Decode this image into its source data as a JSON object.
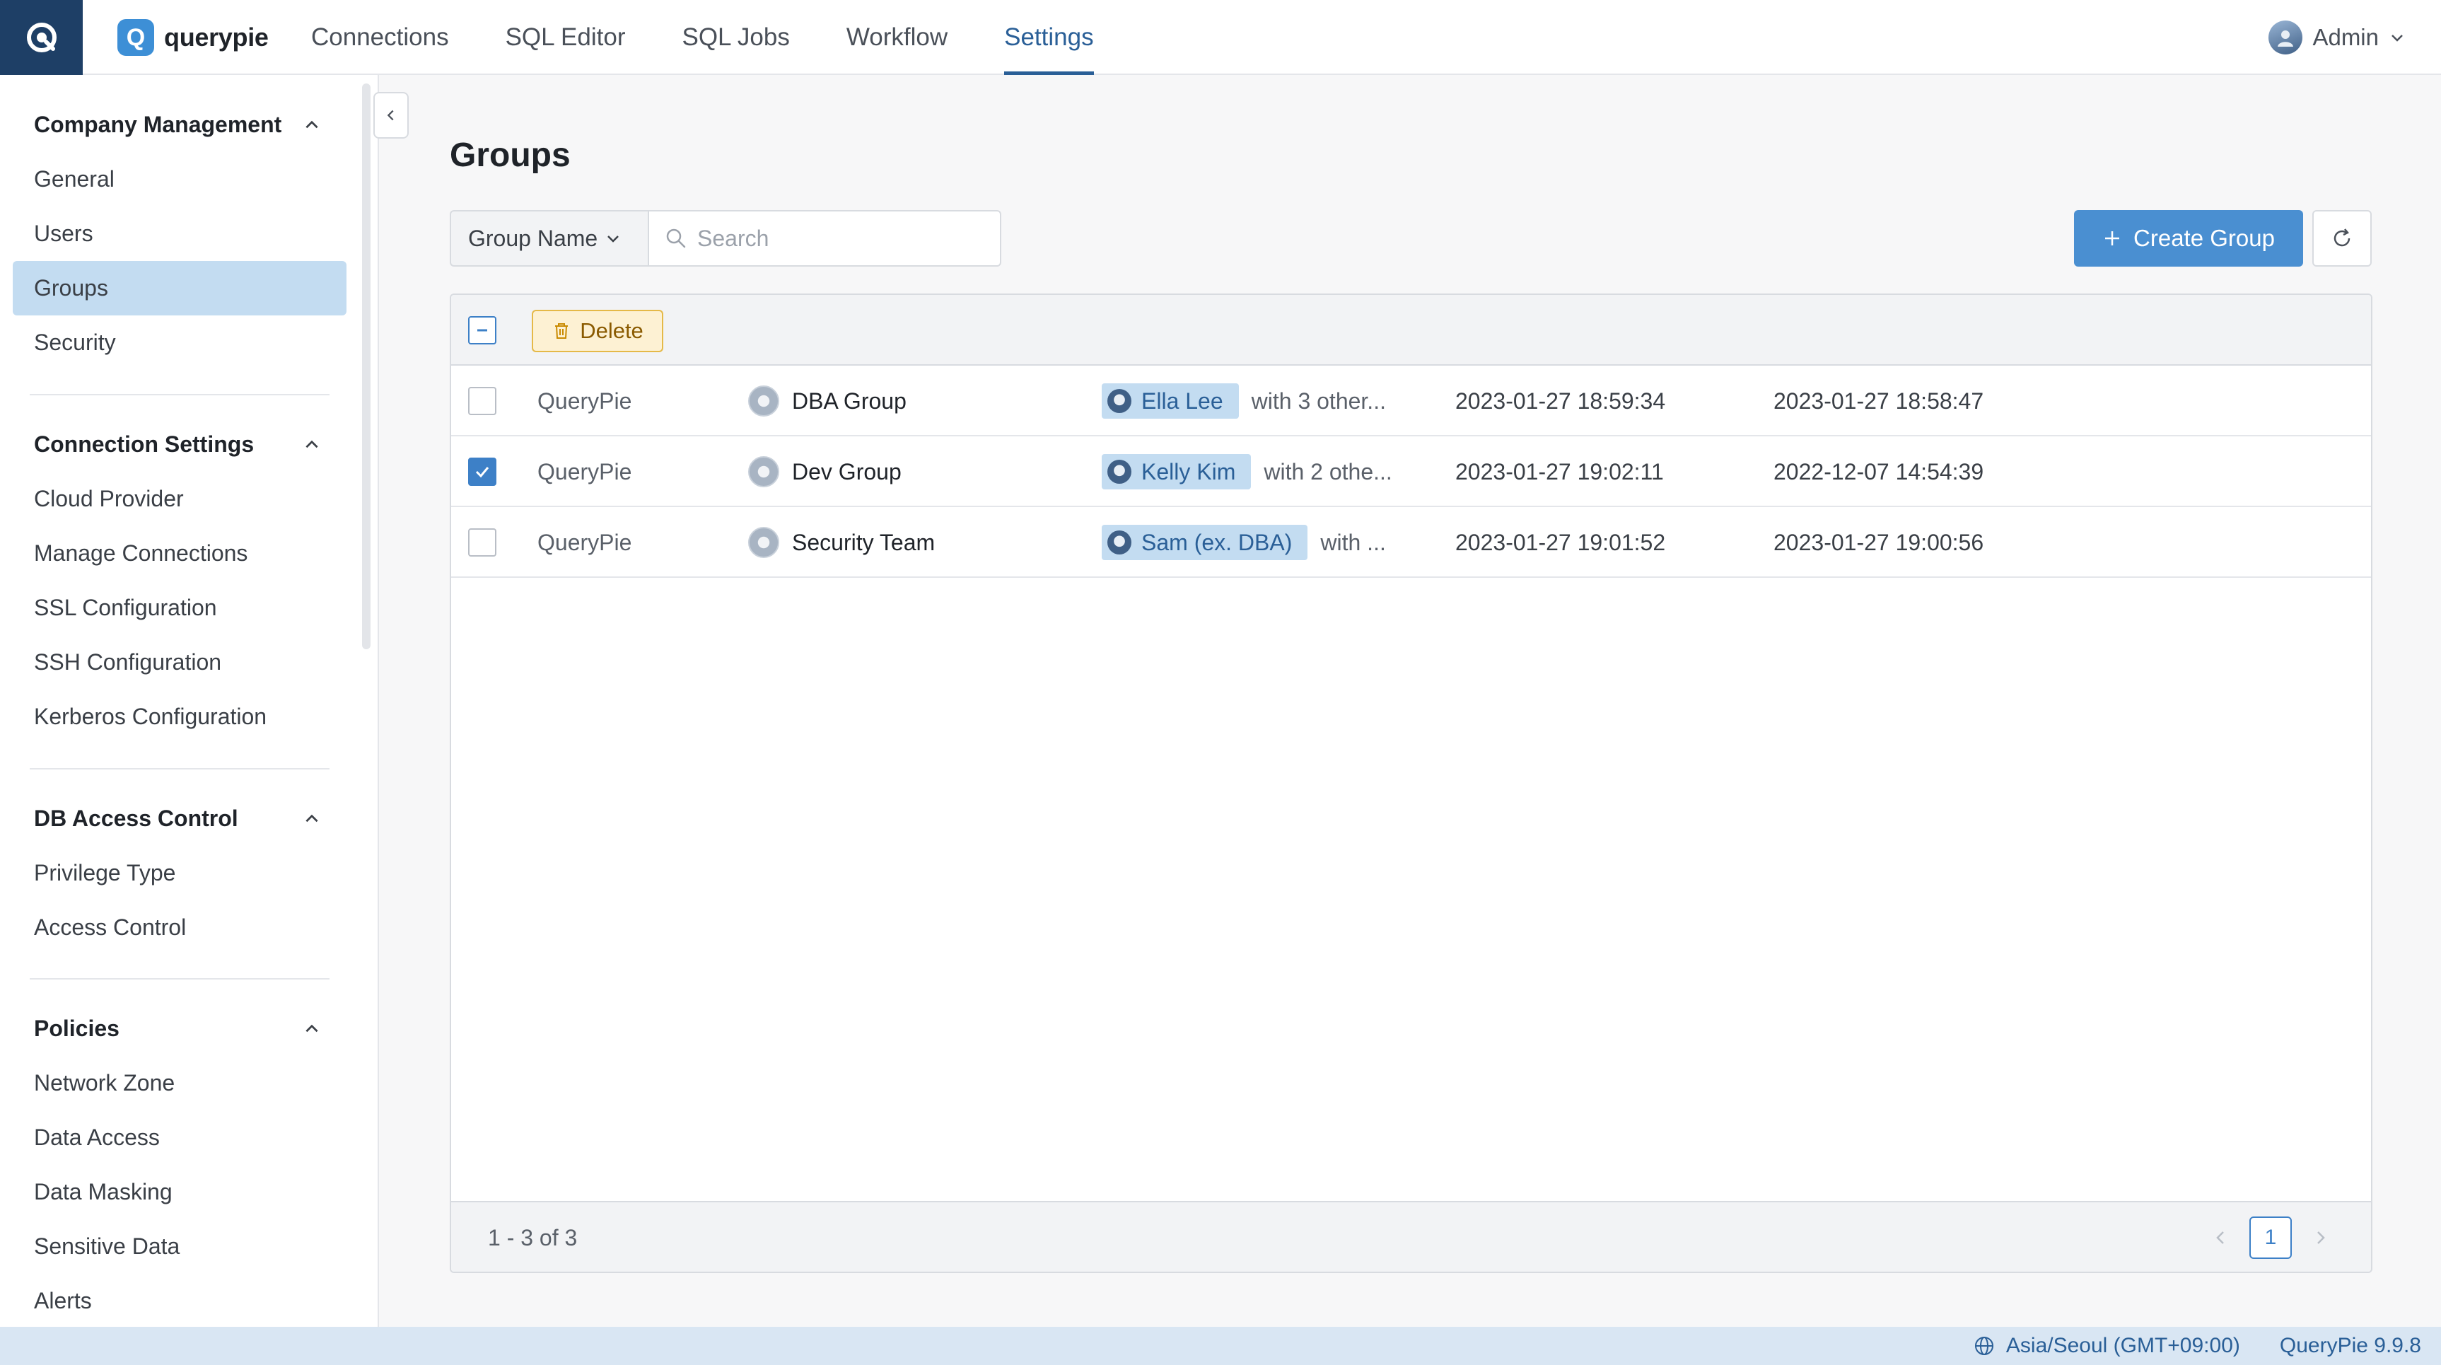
{
  "header": {
    "brand_name": "querypie",
    "brand_letter": "Q",
    "nav": [
      {
        "label": "Connections"
      },
      {
        "label": "SQL Editor"
      },
      {
        "label": "SQL Jobs"
      },
      {
        "label": "Workflow"
      },
      {
        "label": "Settings",
        "active": true
      }
    ],
    "user_label": "Admin"
  },
  "sidebar": {
    "sections": [
      {
        "title": "Company Management",
        "items": [
          "General",
          "Users",
          "Groups",
          "Security"
        ]
      },
      {
        "title": "Connection Settings",
        "items": [
          "Cloud Provider",
          "Manage Connections",
          "SSL Configuration",
          "SSH Configuration",
          "Kerberos Configuration"
        ]
      },
      {
        "title": "DB Access Control",
        "items": [
          "Privilege Type",
          "Access Control"
        ]
      },
      {
        "title": "Policies",
        "items": [
          "Network Zone",
          "Data Access",
          "Data Masking",
          "Sensitive Data",
          "Alerts"
        ]
      }
    ],
    "active_item": "Groups"
  },
  "page": {
    "title": "Groups",
    "filter_label": "Group Name",
    "search_placeholder": "Search",
    "create_label": "Create Group",
    "delete_label": "Delete"
  },
  "table": {
    "rows": [
      {
        "company": "QueryPie",
        "group": "DBA Group",
        "member": "Ella Lee",
        "others": "with 3 other...",
        "updated": "2023-01-27 18:59:34",
        "created": "2023-01-27 18:58:47",
        "checked": false
      },
      {
        "company": "QueryPie",
        "group": "Dev Group",
        "member": "Kelly Kim",
        "others": "with 2 othe...",
        "updated": "2023-01-27 19:02:11",
        "created": "2022-12-07 14:54:39",
        "checked": true
      },
      {
        "company": "QueryPie",
        "group": "Security Team",
        "member": "Sam (ex. DBA)",
        "others": "with ...",
        "updated": "2023-01-27 19:01:52",
        "created": "2023-01-27 19:00:56",
        "checked": false
      }
    ],
    "range_text": "1 - 3 of 3",
    "current_page": "1"
  },
  "status": {
    "timezone": "Asia/Seoul (GMT+09:00)",
    "version": "QueryPie 9.9.8"
  },
  "colors": {
    "accent": "#2a5f97",
    "primary_button": "#4a8fd1",
    "selected_bg": "#c3dcf1",
    "delete_bg": "#fdf1d3"
  }
}
